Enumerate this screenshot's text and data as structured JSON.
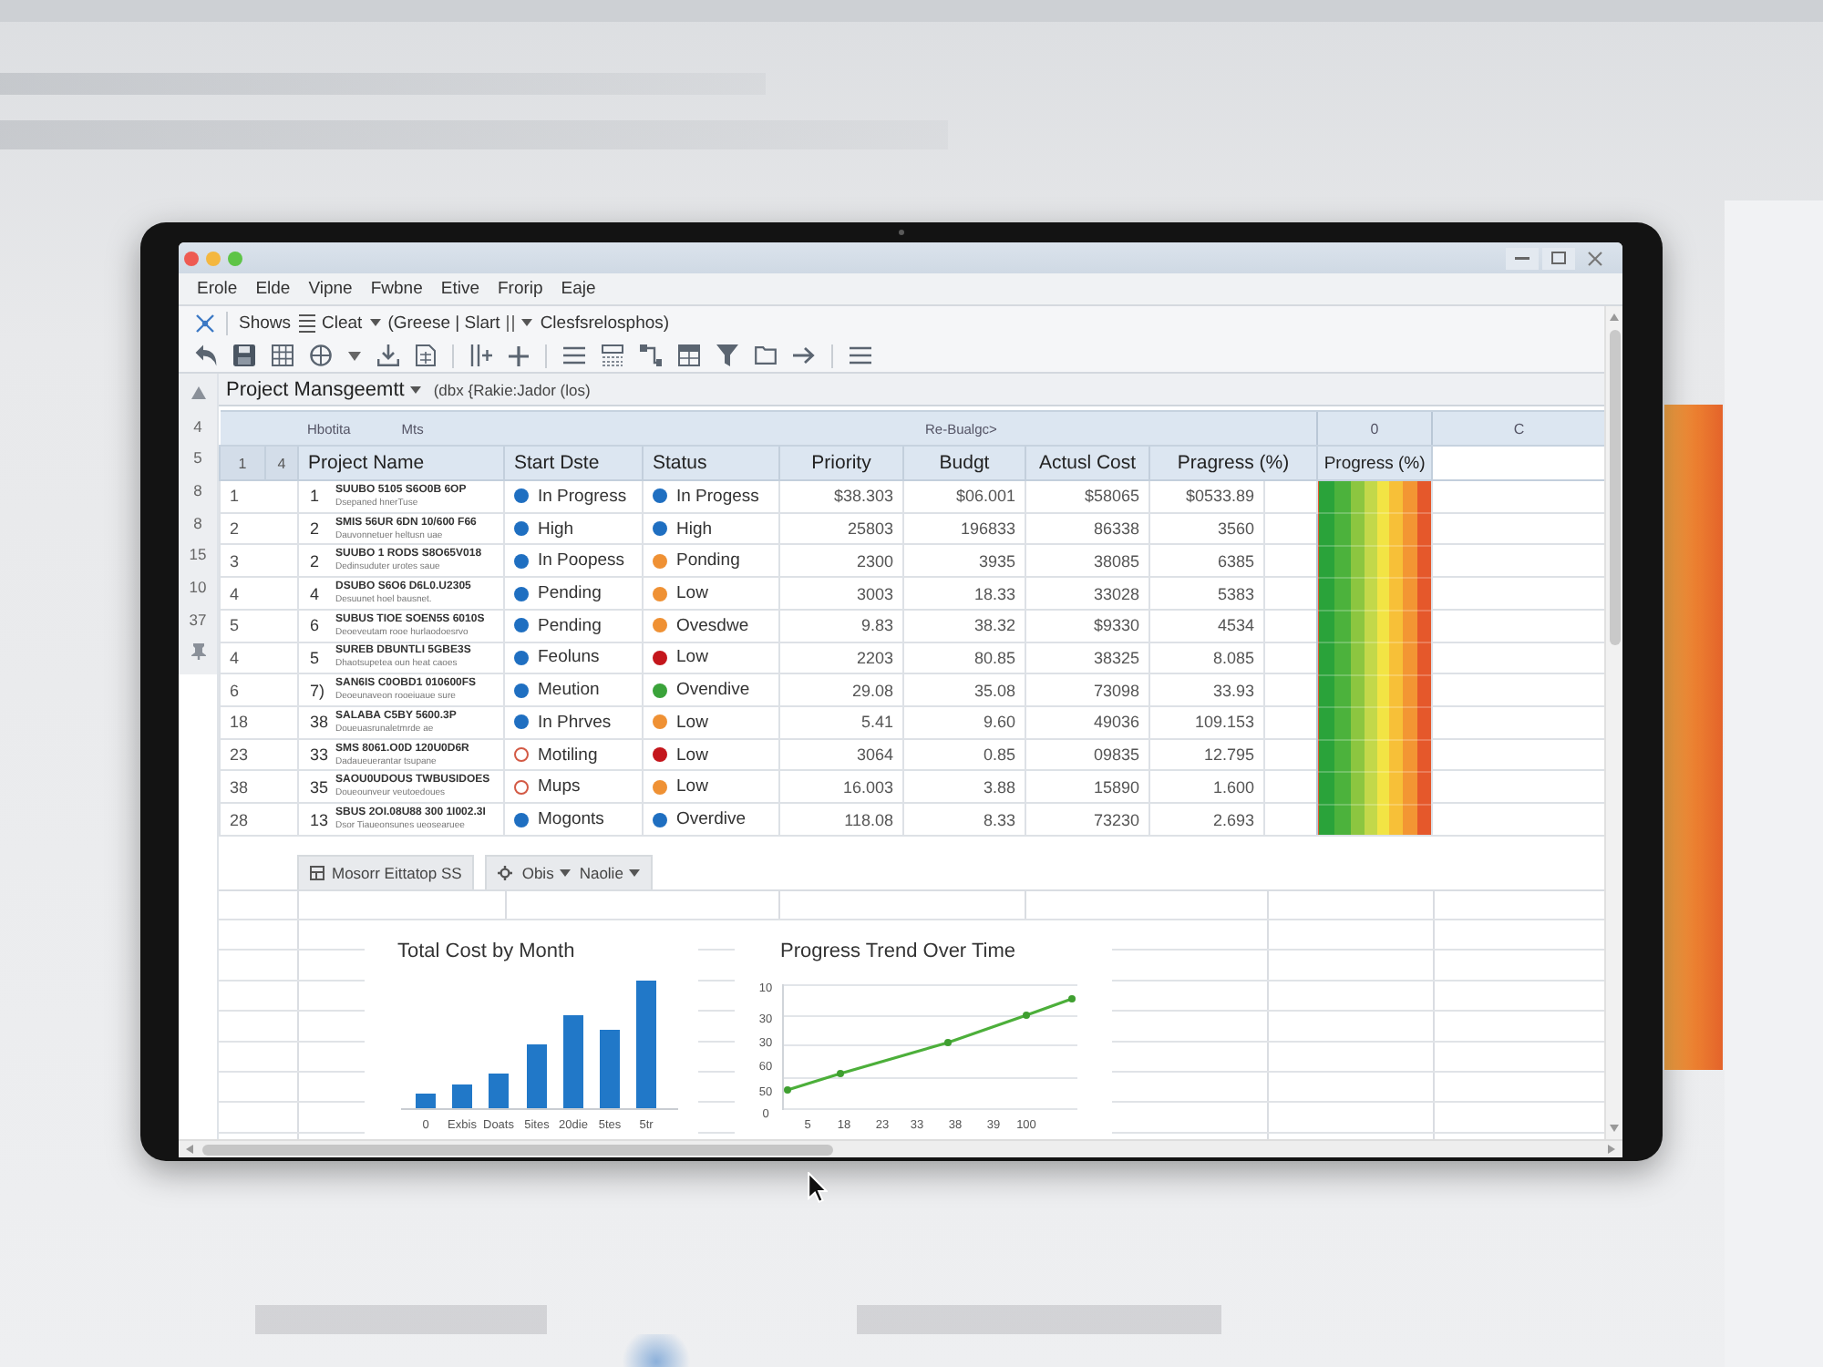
{
  "window": {
    "menu": [
      "Erole",
      "Elde",
      "Vipne",
      "Fwbne",
      "Etive",
      "Frorip",
      "Eaje"
    ]
  },
  "toolbar": [
    "Shows",
    "Cleat",
    "(Greese | Slart",
    "Clesfsrelosphos)"
  ],
  "name_bar": {
    "name": "Project Mansgeemtt",
    "formula": "(dbx {Rakie:Jador (los)"
  },
  "row_gutter": [
    "4",
    "5",
    "8",
    "8",
    "15",
    "10",
    "37"
  ],
  "table": {
    "group_header": [
      "Hbotita",
      "Mts",
      "Re-Bualgc>",
      "0",
      "C"
    ],
    "columns": [
      "1",
      "4",
      "Project Name",
      "Start Dste",
      "Status",
      "Priority",
      "Budgt",
      "Actusl Cost",
      "Pragress (%)",
      "Progress (%)"
    ],
    "rows": [
      {
        "row": "1",
        "number": "1",
        "name": "SUUBO 5105 S6O0B 6OP",
        "note": "Dsepaned hnerTuse",
        "start_date": {
          "kind": "dot",
          "color": "#1f6fc1",
          "text": "In Progress"
        },
        "status": {
          "kind": "dot",
          "color": "#1f6fc1",
          "text": "In Progess"
        },
        "priority": "$38.303",
        "budget": "$06.001",
        "actual_cost": "$58065",
        "progress": "$0533.89"
      },
      {
        "row": "2",
        "number": "2",
        "name": "SMIS 56UR 6DN 10/600 F66",
        "note": "Dauvonnetuer heltusn uae",
        "start_date": {
          "kind": "dot",
          "color": "#1f6fc1",
          "text": "High"
        },
        "status": {
          "kind": "dot",
          "color": "#1f6fc1",
          "text": "High"
        },
        "priority": "25803",
        "budget": "196833",
        "actual_cost": "86338",
        "progress": "3560"
      },
      {
        "row": "3",
        "number": "2",
        "name": "SUUBO 1 RODS S8O65V018",
        "note": "Dedinsuduter urotes saue",
        "start_date": {
          "kind": "dot",
          "color": "#1f6fc1",
          "text": "In Poopess"
        },
        "status": {
          "kind": "dot",
          "color": "#ef9134",
          "text": "Ponding"
        },
        "priority": "2300",
        "budget": "3935",
        "actual_cost": "38085",
        "progress": "6385"
      },
      {
        "row": "4",
        "number": "4",
        "name": "DSUBO S6O6 D6L0.U2305",
        "note": "Desuunet hoel bausnet.",
        "start_date": {
          "kind": "dot",
          "color": "#1f6fc1",
          "text": "Pending"
        },
        "status": {
          "kind": "dot",
          "color": "#ef9134",
          "text": "Low"
        },
        "priority": "3003",
        "budget": "18.33",
        "actual_cost": "33028",
        "progress": "5383"
      },
      {
        "row": "5",
        "number": "6",
        "name": "SUBUS TIOE SOEN5S 6010S",
        "note": "Deoeveutam rooe hurlaodoesrvo",
        "start_date": {
          "kind": "dot",
          "color": "#1f6fc1",
          "text": "Pending"
        },
        "status": {
          "kind": "dot",
          "color": "#ef9134",
          "text": "Ovesdwe"
        },
        "priority": "9.83",
        "budget": "38.32",
        "actual_cost": "$9330",
        "progress": "4534"
      },
      {
        "row": "4",
        "number": "5",
        "name": "SUREB DBUNTLI 5GBE3S",
        "note": "Dhaotsupetea oun heat caoes",
        "start_date": {
          "kind": "dot",
          "color": "#1f6fc1",
          "text": "Feoluns"
        },
        "status": {
          "kind": "dot",
          "color": "#c4161c",
          "text": "Low"
        },
        "priority": "2203",
        "budget": "80.85",
        "actual_cost": "38325",
        "progress": "8.085"
      },
      {
        "row": "6",
        "number": "7)",
        "name": "SAN6IS C0OBD1 010600FS",
        "note": "Deoeunaveon rooeiuaue sure",
        "start_date": {
          "kind": "dot",
          "color": "#1f6fc1",
          "text": "Meution"
        },
        "status": {
          "kind": "dot",
          "color": "#3aa33a",
          "text": "Ovendive"
        },
        "priority": "29.08",
        "budget": "35.08",
        "actual_cost": "73098",
        "progress": "33.93"
      },
      {
        "row": "18",
        "number": "38",
        "name": "SALABA C5BY 5600.3P",
        "note": "Doueuasrunaletmrde ae",
        "start_date": {
          "kind": "dot",
          "color": "#1f6fc1",
          "text": "In Phrves"
        },
        "status": {
          "kind": "dot",
          "color": "#ef9134",
          "text": "Low"
        },
        "priority": "5.41",
        "budget": "9.60",
        "actual_cost": "49036",
        "progress": "109.153"
      },
      {
        "row": "23",
        "number": "33",
        "name": "SMS 8061.O0D 120U0D6R",
        "note": "Dadaueuerantar tsupane",
        "start_date": {
          "kind": "ring",
          "color": "#d35a45",
          "text": "Motiling"
        },
        "status": {
          "kind": "dot",
          "color": "#c4161c",
          "text": "Low"
        },
        "priority": "3064",
        "budget": "0.85",
        "actual_cost": "09835",
        "progress": "12.795"
      },
      {
        "row": "38",
        "number": "35",
        "name": "SAOU0UDOUS TWBUSIDOES",
        "note": "Doueounveur veutoedoues",
        "start_date": {
          "kind": "ring",
          "color": "#d35a45",
          "text": "Mups"
        },
        "status": {
          "kind": "dot",
          "color": "#ef9134",
          "text": "Low"
        },
        "priority": "16.003",
        "budget": "3.88",
        "actual_cost": "15890",
        "progress": "1.600"
      },
      {
        "row": "28",
        "number": "13",
        "name": "SBUS 2OI.08U88 300 1I002.3I",
        "note": "Dsor Tiaueonsunes ueosearuee",
        "start_date": {
          "kind": "dot",
          "color": "#1f6fc1",
          "text": "Mogonts"
        },
        "status": {
          "kind": "dot",
          "color": "#1f6fc1",
          "text": "Overdive"
        },
        "priority": "118.08",
        "budget": "8.33",
        "actual_cost": "73230",
        "progress": "2.693"
      }
    ]
  },
  "chart_toolbar": {
    "layout_button": "Mosorr Eittatop SS",
    "dropdowns": [
      "Obis",
      "Naolie"
    ]
  },
  "charts": [
    {
      "kind": "bar",
      "title": "Total Cost by Month",
      "x_labels": [
        "0",
        "Exbis",
        "Doats",
        "5ites",
        "20die",
        "5tes",
        "5tr"
      ]
    },
    {
      "kind": "line",
      "title": "Progress Trend Over Time",
      "y_labels": [
        "10",
        "30",
        "30",
        "60",
        "50",
        "0"
      ],
      "x_labels": [
        "5",
        "18",
        "23",
        "33",
        "38",
        "39",
        "100"
      ]
    }
  ]
}
